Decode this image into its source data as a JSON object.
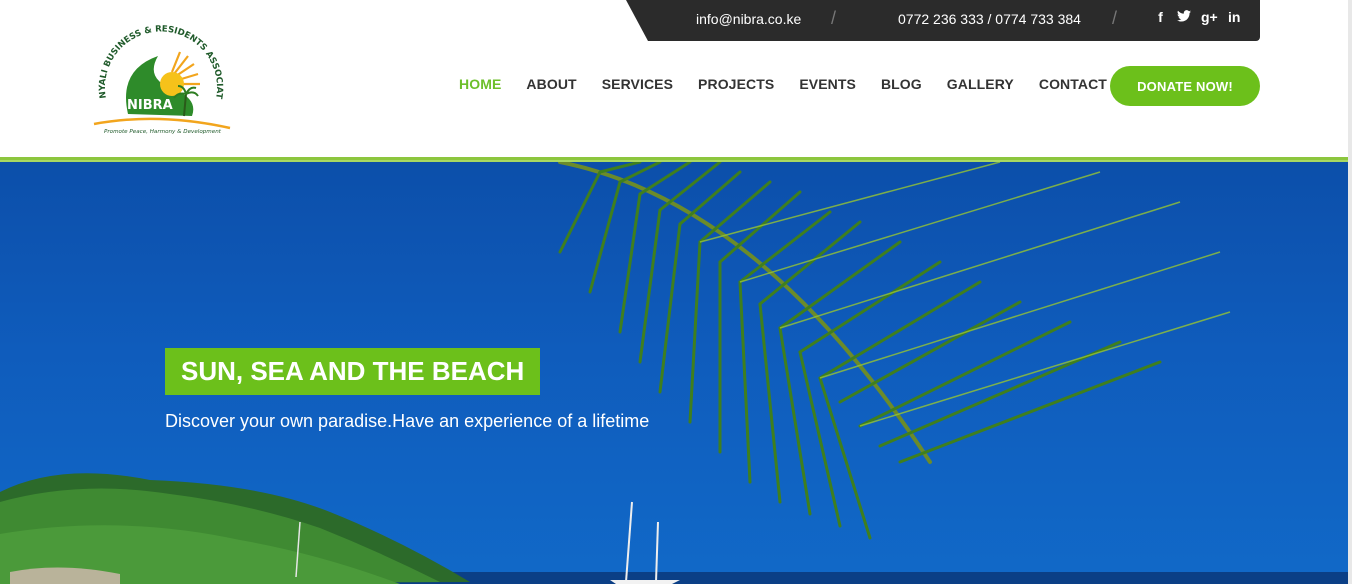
{
  "topbar": {
    "email": "info@nibra.co.ke",
    "phone": "0772 236 333 / 0774 733 384",
    "separator": "/",
    "social": {
      "facebook": "f",
      "twitter": "t",
      "googleplus": "g+",
      "linkedin": "in"
    }
  },
  "logo": {
    "name": "NIBRA",
    "arc_text": "NYALI BUSINESS & RESIDENTS ASSOCIATION",
    "tagline": "Promote Peace, Harmony & Development"
  },
  "nav": {
    "items": [
      "HOME",
      "ABOUT",
      "SERVICES",
      "PROJECTS",
      "EVENTS",
      "BLOG",
      "GALLERY",
      "CONTACT US"
    ],
    "donate": "DONATE NOW!"
  },
  "hero": {
    "title": "SUN, SEA AND THE BEACH",
    "subtitle": "Discover your own paradise.Have an experience of a lifetime"
  },
  "colors": {
    "accent": "#6cc01b",
    "topbar": "#2b2b2b",
    "sky": "#0f5cbc"
  }
}
